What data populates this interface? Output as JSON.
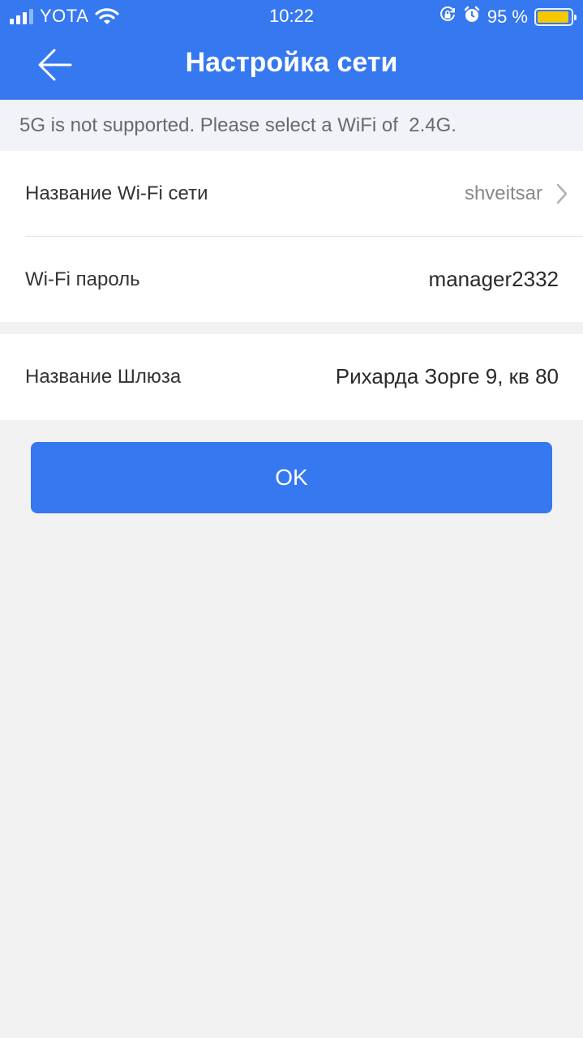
{
  "status_bar": {
    "carrier": "YOTA",
    "time": "10:22",
    "battery": "95 %",
    "signal_bars_active": 3,
    "signal_bars_total": 4,
    "battery_level": 0.95,
    "icons": [
      "cellular-signal-icon",
      "wifi-icon",
      "orientation-lock-icon",
      "alarm-icon",
      "battery-icon"
    ]
  },
  "nav": {
    "title": "Настройка сети",
    "back_icon": "back-arrow-icon"
  },
  "notice": "5G is not supported. Please select a WiFi of  2.4G.",
  "wifi_section": {
    "ssid_label": "Название Wi-Fi сети",
    "ssid_value": "shveitsar",
    "password_label": "Wi-Fi пароль",
    "password_value": "manager2332"
  },
  "gateway_section": {
    "name_label": "Название Шлюза",
    "name_value": "Рихарда Зорге 9, кв 80"
  },
  "ok_button": "OK",
  "colors": {
    "primary": "#3678f0",
    "battery": "#f6c800",
    "page_background": "#f2f2f2"
  }
}
